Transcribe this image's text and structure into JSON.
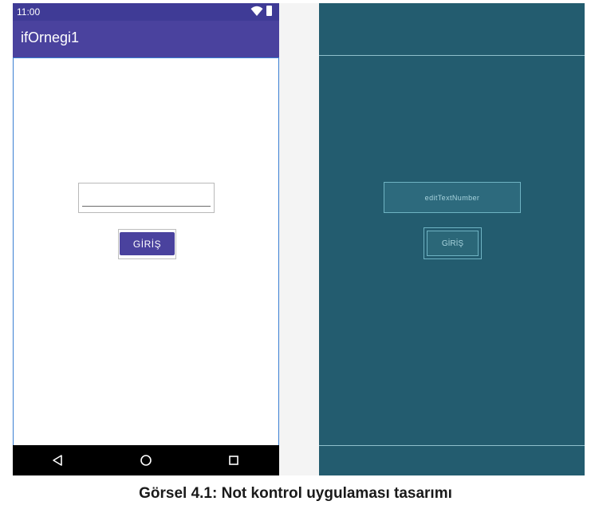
{
  "status_bar": {
    "time": "11:00",
    "icons": [
      "wifi-icon",
      "battery-icon"
    ]
  },
  "app_bar": {
    "title": "ifOrnegi1"
  },
  "edit_text": {
    "value": "",
    "placeholder": ""
  },
  "button": {
    "label": "GİRİŞ"
  },
  "nav_bar": {
    "icons": [
      "back-icon",
      "home-icon",
      "recents-icon"
    ]
  },
  "blueprint": {
    "edit_label": "editTextNumber",
    "button_label": "GİRİŞ"
  },
  "caption": "Görsel 4.1: Not kontrol uygulaması tasarımı",
  "colors": {
    "primary": "#4a429e",
    "status_bar": "#3f3b96",
    "blueprint_bg": "#235c6f",
    "blueprint_line": "#8fbfcc"
  }
}
